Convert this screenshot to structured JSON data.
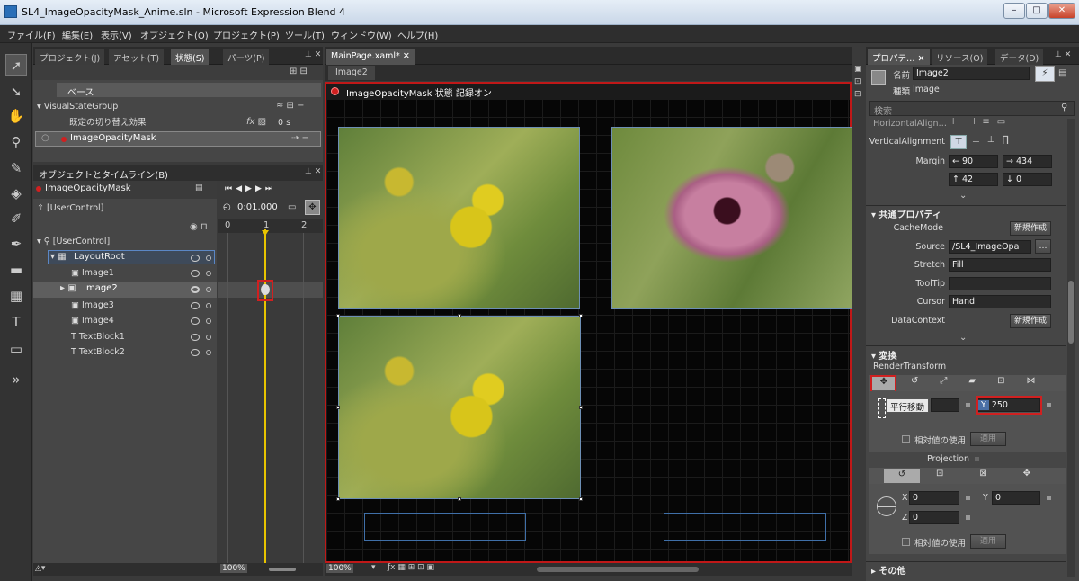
{
  "window": {
    "title": "SL4_ImageOpacityMask_Anime.sln - Microsoft Expression Blend 4"
  },
  "menu": [
    "ファイル(F)",
    "編集(E)",
    "表示(V)",
    "オブジェクト(O)",
    "プロジェクト(P)",
    "ツール(T)",
    "ウィンドウ(W)",
    "ヘルプ(H)"
  ],
  "left_tabs": [
    "プロジェクト(J)",
    "アセット(T)",
    "状態(S)",
    "パーツ(P)"
  ],
  "states": {
    "base": "ベース",
    "group": "VisualStateGroup",
    "default_transition": "既定の切り替え効果",
    "transition_time": "0 s",
    "state": "ImageOpacityMask"
  },
  "objects": {
    "header": "オブジェクトとタイムライン(B)",
    "storyboard": "ImageOpacityMask",
    "scope": "[UserControl]",
    "time": "0:01.000",
    "ruler": [
      "0",
      "1",
      "2"
    ],
    "tree": [
      {
        "label": "[UserControl]"
      },
      {
        "label": "LayoutRoot"
      },
      {
        "label": "Image1"
      },
      {
        "label": "Image2"
      },
      {
        "label": "Image3"
      },
      {
        "label": "Image4"
      },
      {
        "label": "TextBlock1"
      },
      {
        "label": "TextBlock2"
      }
    ],
    "zoom": "100%"
  },
  "doc": {
    "tab": "MainPage.xaml*",
    "breadcrumb": "Image2",
    "recording": "ImageOpacityMask 状態 記録オン",
    "zoom": "100%"
  },
  "right_tabs": [
    "プロパテ…",
    "リソース(O)",
    "データ(D)"
  ],
  "props": {
    "name_label": "名前",
    "name_value": "Image2",
    "type_label": "種類",
    "type_value": "Image",
    "search_placeholder": "検索",
    "halign_label": "HorizontalAlign…",
    "valign_label": "VerticalAlignment",
    "margin_label": "Margin",
    "margin": {
      "left": "90",
      "right": "434",
      "top": "42",
      "bottom": "0"
    },
    "common_header": "共通プロパティ",
    "cachemode_label": "CacheMode",
    "new_btn": "新規作成",
    "source_label": "Source",
    "source_value": "/SL4_ImageOpa",
    "stretch_label": "Stretch",
    "stretch_value": "Fill",
    "tooltip_label": "ToolTip",
    "cursor_label": "Cursor",
    "cursor_value": "Hand",
    "datacontext_label": "DataContext",
    "transform_header": "変換",
    "render_label": "RenderTransform",
    "translate_tooltip": "平行移動",
    "y_label": "Y",
    "y_value": "250",
    "relative_label": "相対値の使用",
    "apply_btn": "適用",
    "projection_label": "Projection",
    "px_label": "X",
    "px_value": "0",
    "py_label": "Y",
    "py_value": "0",
    "pz_label": "Z",
    "pz_value": "0",
    "other_header": "その他",
    "ellipsis": "…"
  },
  "colors": {
    "accent_red": "#d02020",
    "timeline_yellow": "#e8c400"
  }
}
